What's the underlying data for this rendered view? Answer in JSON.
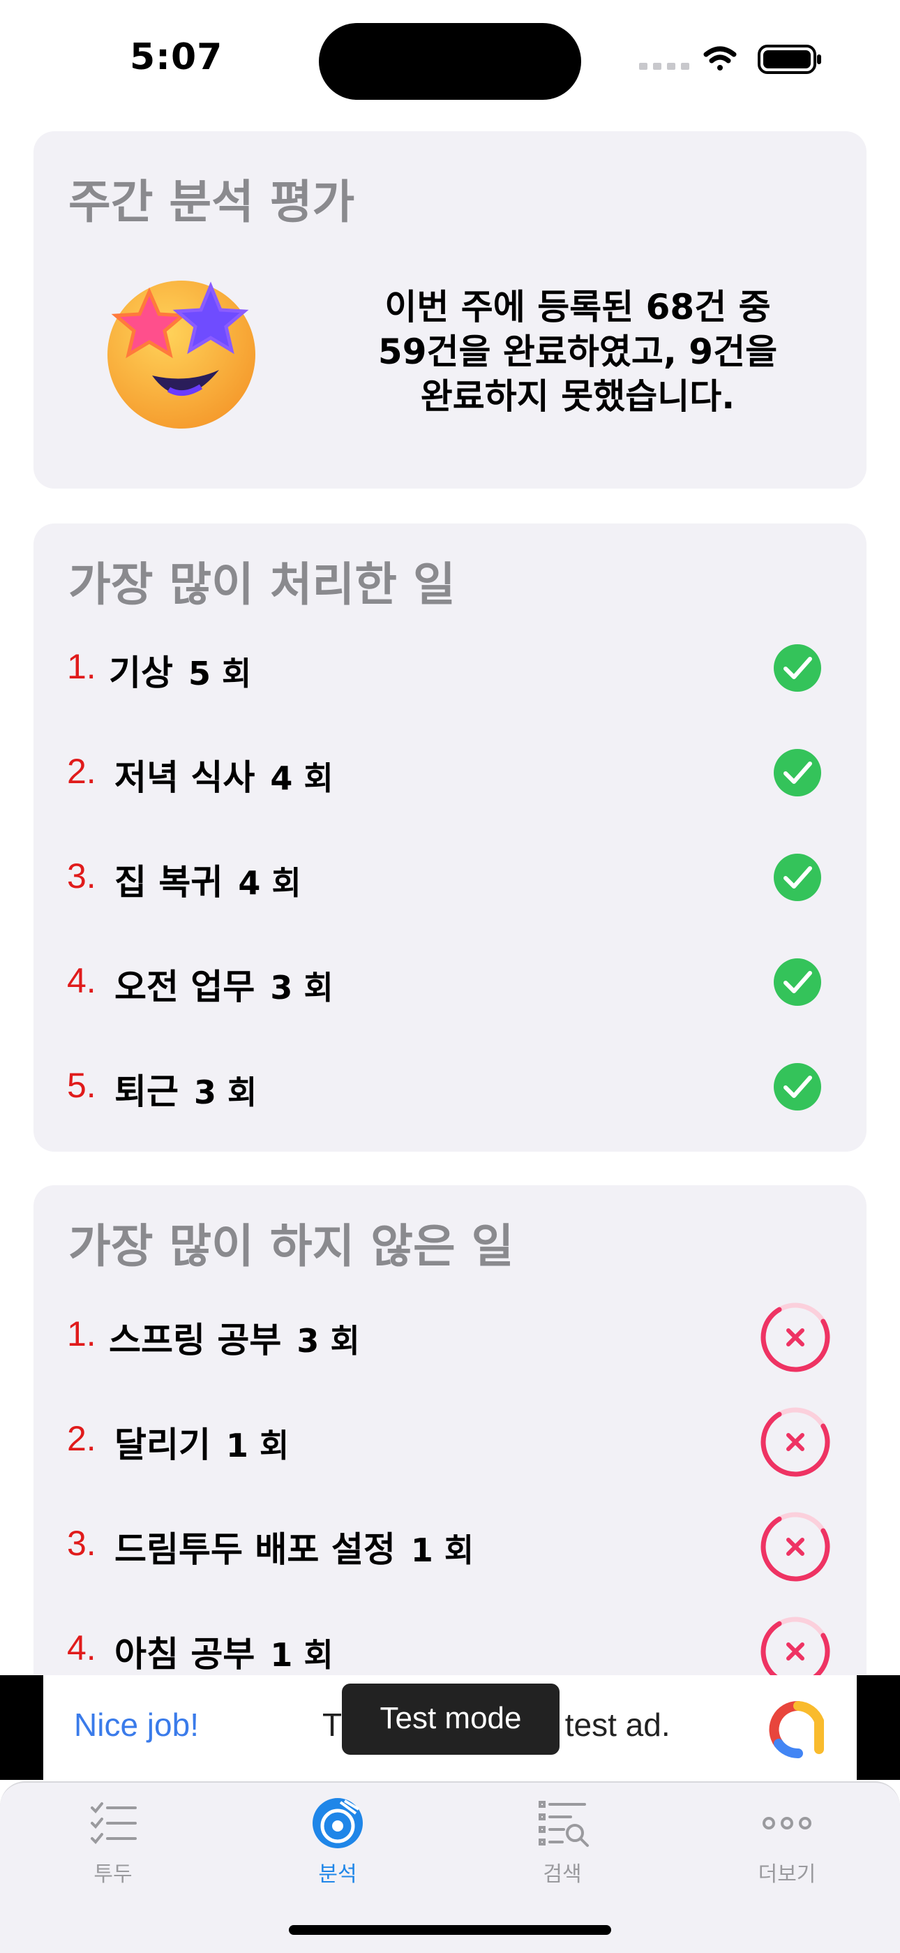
{
  "status": {
    "time": "5:07"
  },
  "summary": {
    "title": "주간 분석 평가",
    "line1": "이번 주에 등록된 68건 중",
    "line2": "59건을 완료하였고, 9건을",
    "line3": "완료하지 못했습니다."
  },
  "top_done": {
    "title": "가장 많이 처리한 일",
    "items": [
      {
        "rank": "1.",
        "task": "기상",
        "count": "5 회"
      },
      {
        "rank": "2.",
        "task": "저녁 식사",
        "count": "4 회"
      },
      {
        "rank": "3.",
        "task": "집 복귀",
        "count": "4 회"
      },
      {
        "rank": "4.",
        "task": "오전 업무",
        "count": "3 회"
      },
      {
        "rank": "5.",
        "task": "퇴근",
        "count": "3 회"
      }
    ]
  },
  "top_undone": {
    "title": "가장 많이 하지 않은 일",
    "items": [
      {
        "rank": "1.",
        "task": "스프링 공부",
        "count": "3 회"
      },
      {
        "rank": "2.",
        "task": "달리기",
        "count": "1 회"
      },
      {
        "rank": "3.",
        "task": "드림투두 배포 설정",
        "count": "1 회"
      },
      {
        "rank": "4.",
        "task": "아침 공부",
        "count": "1 회"
      }
    ]
  },
  "ad": {
    "headline": "Nice job!",
    "text": "This is a 320x50 test ad.",
    "badge": "Test mode"
  },
  "tabs": [
    {
      "label": "투두",
      "icon": "checklist-icon"
    },
    {
      "label": "분석",
      "icon": "chart-disc-icon"
    },
    {
      "label": "검색",
      "icon": "search-list-icon"
    },
    {
      "label": "더보기",
      "icon": "more-icon"
    }
  ],
  "colors": {
    "accent": "#1f86e8",
    "rank": "#e01b1b",
    "check": "#34c35a",
    "fail": "#ee3363"
  }
}
